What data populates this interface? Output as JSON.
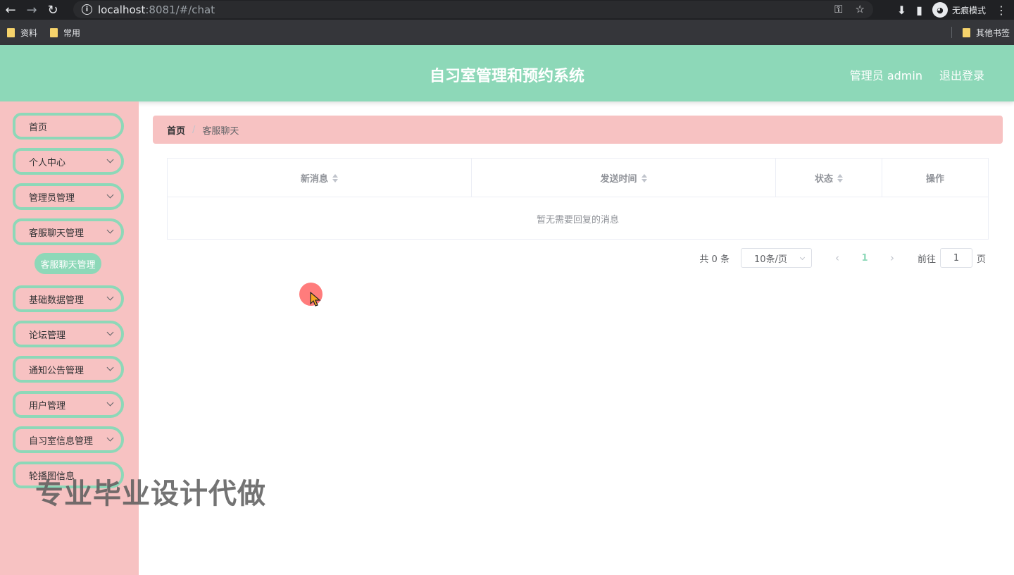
{
  "browser": {
    "url_host": "localhost",
    "url_rest": ":8081/#/chat",
    "incognito_label": "无痕模式",
    "bookmarks": [
      "资料",
      "常用"
    ],
    "other_bookmarks": "其他书签"
  },
  "header": {
    "title": "自习室管理和预约系统",
    "user": "管理员 admin",
    "logout": "退出登录",
    "color": "#8dd8b8"
  },
  "sidebar": {
    "items": [
      {
        "label": "首页",
        "expandable": false
      },
      {
        "label": "个人中心",
        "expandable": true
      },
      {
        "label": "管理员管理",
        "expandable": true
      },
      {
        "label": "客服聊天管理",
        "expandable": true
      },
      {
        "label": "基础数据管理",
        "expandable": true
      },
      {
        "label": "论坛管理",
        "expandable": true
      },
      {
        "label": "通知公告管理",
        "expandable": true
      },
      {
        "label": "用户管理",
        "expandable": true
      },
      {
        "label": "自习室信息管理",
        "expandable": true
      },
      {
        "label": "轮播图信息",
        "expandable": false
      }
    ],
    "active_sub": "客服聊天管理",
    "color": "#f7c2c2"
  },
  "breadcrumb": {
    "home": "首页",
    "separator": "/",
    "current": "客服聊天"
  },
  "table": {
    "columns": [
      "新消息",
      "发送时间",
      "状态",
      "操作"
    ],
    "empty_text": "暂无需要回复的消息"
  },
  "pagination": {
    "total": "共 0 条",
    "page_size": "10条/页",
    "current_page": "1",
    "goto_label": "前往",
    "goto_value": "1",
    "page_unit": "页"
  },
  "watermark": "专业毕业设计代做"
}
